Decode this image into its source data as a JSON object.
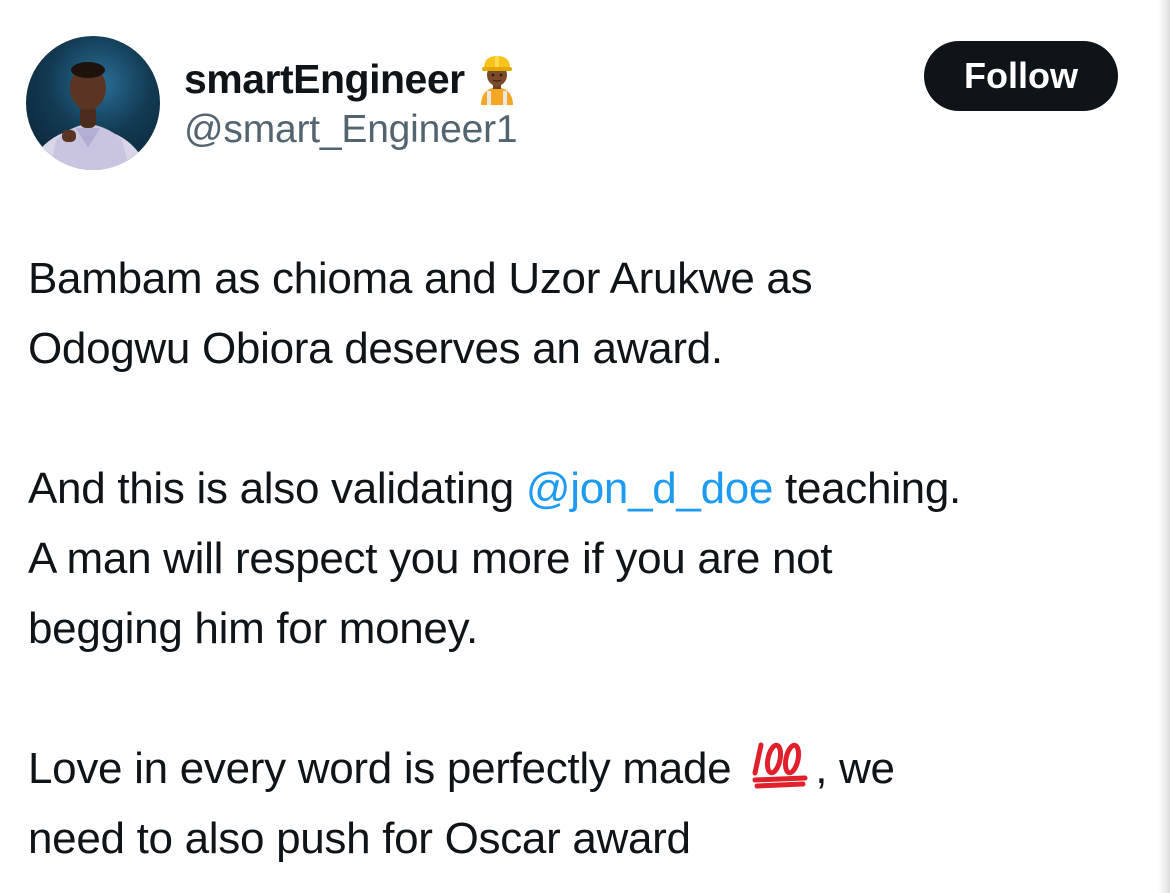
{
  "author": {
    "display_name": "smartEngineer",
    "name_emoji": "construction-worker-emoji",
    "handle": "@smart_Engineer1"
  },
  "follow_button": {
    "label": "Follow"
  },
  "tweet": {
    "paragraph1": {
      "line1": "Bambam as chioma and Uzor Arukwe as",
      "line2": "Odogwu Obiora deserves an award."
    },
    "paragraph2": {
      "line1_before": "And this is also validating ",
      "mention": "@jon_d_doe",
      "line1_after": " teaching.",
      "line2": "A man will respect you more if you are not",
      "line3": "begging him for money."
    },
    "paragraph3": {
      "line1_before": "Love in every word is perfectly made ",
      "emoji": "hundred-points-emoji",
      "line1_after": ", we",
      "line2": "need to also push for Oscar award"
    }
  },
  "colors": {
    "text": "#0f1419",
    "secondary_text": "#536471",
    "mention": "#1d9bf0",
    "button_bg": "#0f1419",
    "button_text": "#ffffff"
  }
}
